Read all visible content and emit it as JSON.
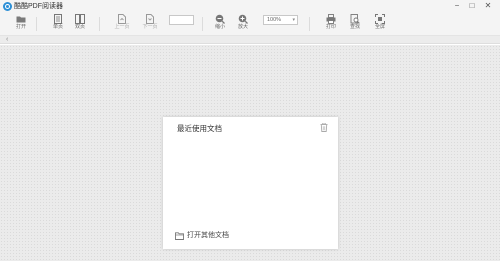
{
  "window": {
    "title": "酷酷PDF阅读器",
    "minimize": "−",
    "restore": "□",
    "close": "✕"
  },
  "toolbar": {
    "open": "打开",
    "single_page": "单页",
    "double_page": "双页",
    "prev_page": "上一页",
    "next_page": "下一页",
    "page_number": "",
    "zoom_out": "缩小",
    "zoom_in": "放大",
    "zoom_level": "100%",
    "print": "打印",
    "search": "查找",
    "fullscreen": "全屏"
  },
  "recent_panel": {
    "title": "最近使用文档",
    "open_other": "打开其他文档"
  },
  "colors": {
    "accent": "#2c8fd6",
    "workspace": "#ebebeb"
  }
}
